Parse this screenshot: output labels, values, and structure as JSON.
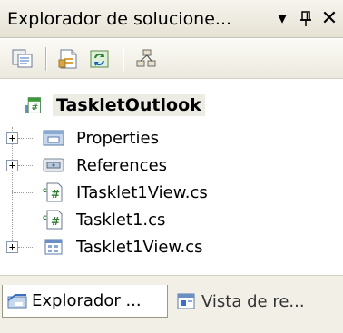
{
  "window": {
    "title": "Explorador de solucione...",
    "dropdown_glyph": "▾",
    "pin_glyph": "ꟸ",
    "close_glyph": "✕"
  },
  "toolbar": {
    "buttons": [
      {
        "name": "show-all-files-icon"
      },
      {
        "name": "properties-icon"
      },
      {
        "name": "refresh-icon"
      },
      {
        "name": "view-class-diagram-icon"
      }
    ]
  },
  "tree": {
    "root": {
      "label": "TaskletOutlook",
      "icon": "csharp-project-icon"
    },
    "items": [
      {
        "label": "Properties",
        "icon": "properties-folder-icon",
        "expandable": true
      },
      {
        "label": "References",
        "icon": "references-folder-icon",
        "expandable": true
      },
      {
        "label": "ITasklet1View.cs",
        "icon": "csharp-file-icon",
        "expandable": false
      },
      {
        "label": "Tasklet1.cs",
        "icon": "csharp-file-icon",
        "expandable": false
      },
      {
        "label": "Tasklet1View.cs",
        "icon": "form-file-icon",
        "expandable": true
      }
    ]
  },
  "tabs": [
    {
      "label": "Explorador ...",
      "active": true
    },
    {
      "label": "Vista de re...",
      "active": false
    }
  ]
}
